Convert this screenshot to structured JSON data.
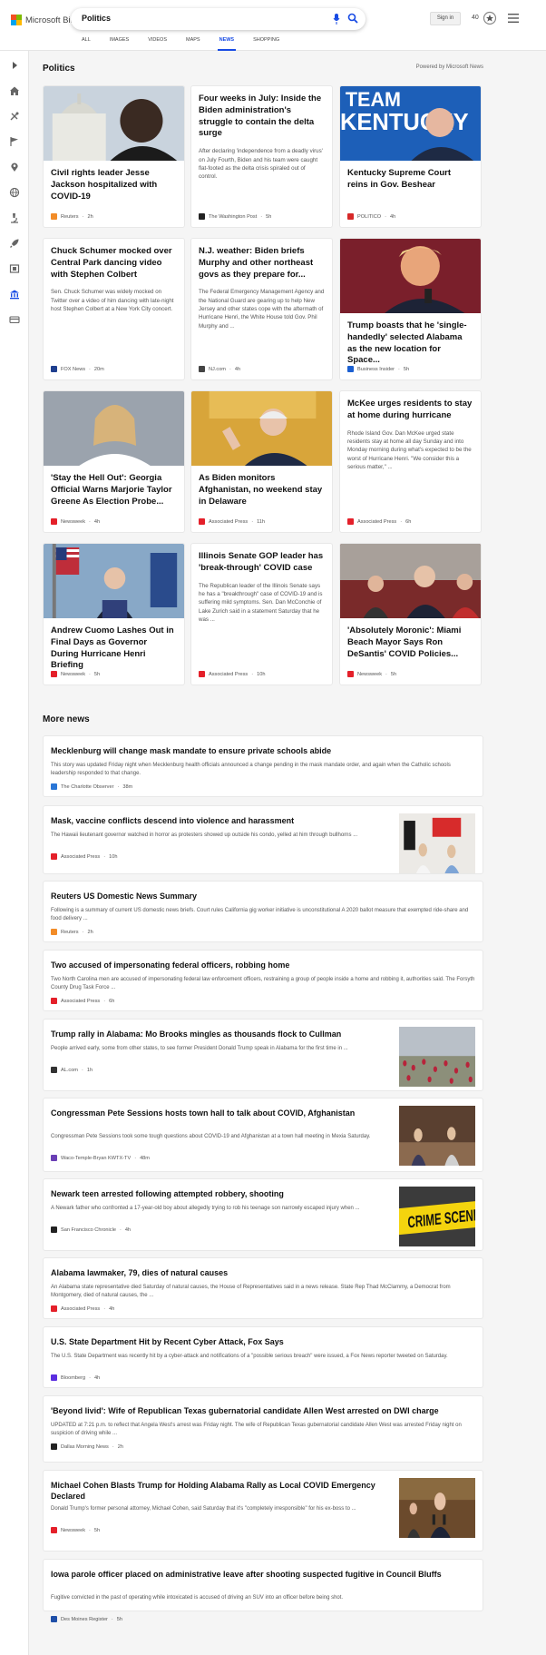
{
  "header": {
    "brand": "Microsoft Bing",
    "search_query": "Politics",
    "signin_label": "Sign in",
    "points": "40",
    "nav_items": [
      "ALL",
      "IMAGES",
      "VIDEOS",
      "MAPS",
      "NEWS",
      "SHOPPING"
    ],
    "active_nav": "NEWS"
  },
  "rail": {
    "icons": [
      "chevron-right-icon",
      "home-icon",
      "sports-icon",
      "flag-icon",
      "location-icon",
      "globe-icon",
      "microscope-icon",
      "rocket-icon",
      "film-icon",
      "bank-icon",
      "card-icon"
    ]
  },
  "politics": {
    "title": "Politics",
    "powered_by": "Powered by Microsoft News",
    "cards": [
      {
        "title": "Civil rights leader Jesse Jackson hospitalized with COVID-19",
        "desc": "",
        "source": "Reuters",
        "time": "2h",
        "src_color": "#f28c28",
        "image": "jackson"
      },
      {
        "title": "Four weeks in July: Inside the Biden administration's struggle to contain the delta surge",
        "desc": "After declaring 'independence from a deadly virus' on July Fourth, Biden and his team were caught flat-footed as the delta crisis spiraled out of control.",
        "source": "The Washington Post",
        "time": "5h",
        "src_color": "#222222",
        "image": ""
      },
      {
        "title": "Kentucky Supreme Court reins in Gov. Beshear",
        "desc": "",
        "source": "POLITICO",
        "time": "4h",
        "src_color": "#d62828",
        "image": "kentucky"
      },
      {
        "title": "Chuck Schumer mocked over Central Park dancing video with Stephen Colbert",
        "desc": "Sen. Chuck Schumer was widely mocked on Twitter over a video of him dancing with late-night host Stephen Colbert at a New York City concert.",
        "source": "FOX News",
        "time": "20m",
        "src_color": "#1f3f8f",
        "image": ""
      },
      {
        "title": "N.J. weather: Biden briefs Murphy and other northeast govs as they prepare for...",
        "desc": "The Federal Emergency Management Agency and the National Guard are gearing up to help New Jersey and other states cope with the aftermath of Hurricane Henri, the White House told Gov. Phil Murphy and ...",
        "source": "NJ.com",
        "time": "4h",
        "src_color": "#444444",
        "image": ""
      },
      {
        "title": "Trump boasts that he 'single-handedly' selected Alabama as the new location for Space...",
        "desc": "",
        "source": "Business Insider",
        "time": "5h",
        "src_color": "#1b5fd1",
        "image": "trump"
      },
      {
        "title": "'Stay the Hell Out': Georgia Official Warns Marjorie Taylor Greene As Election Probe...",
        "desc": "",
        "source": "Newsweek",
        "time": "4h",
        "src_color": "#e4202a",
        "image": "greene"
      },
      {
        "title": "As Biden monitors Afghanistan, no weekend stay in Delaware",
        "desc": "",
        "source": "Associated Press",
        "time": "11h",
        "src_color": "#e4202a",
        "image": "biden"
      },
      {
        "title": "McKee urges residents to stay at home during hurricane",
        "desc": "Rhode Island Gov. Dan McKee urged state residents stay at home all day Sunday and into Monday morning during what's expected to be the worst of Hurricane Henri. \"We consider this a serious matter,\" ...",
        "source": "Associated Press",
        "time": "6h",
        "src_color": "#e4202a",
        "image": ""
      },
      {
        "title": "Andrew Cuomo Lashes Out in Final Days as Governor During Hurricane Henri Briefing",
        "desc": "",
        "source": "Newsweek",
        "time": "5h",
        "src_color": "#e4202a",
        "image": "cuomo"
      },
      {
        "title": "Illinois Senate GOP leader has 'break-through' COVID case",
        "desc": "The Republican leader of the Illinois Senate says he has a \"breakthrough\" case of COVID-19 and is suffering mild symptoms. Sen. Dan McConchie of Lake Zurich said in a statement Saturday that he was ...",
        "source": "Associated Press",
        "time": "10h",
        "src_color": "#e4202a",
        "image": ""
      },
      {
        "title": "'Absolutely Moronic': Miami Beach Mayor Says Ron DeSantis' COVID Policies...",
        "desc": "",
        "source": "Newsweek",
        "time": "5h",
        "src_color": "#e4202a",
        "image": "desantis"
      }
    ]
  },
  "more_news": {
    "title": "More news",
    "items": [
      {
        "title": "Mecklenburg will change mask mandate to ensure private schools abide",
        "desc": "This story was updated Friday night when Mecklenburg health officials announced a change pending in the mask mandate order, and again when the Catholic schools leadership responded to that change.",
        "source": "The Charlotte Observer",
        "time": "38m",
        "src_color": "#2a76d6",
        "image": ""
      },
      {
        "title": "Mask, vaccine conflicts descend into violence and harassment",
        "desc": "The Hawaii lieutenant governor watched in horror as protesters showed up outside his condo, yelled at him through bullhorns ...",
        "source": "Associated Press",
        "time": "10h",
        "src_color": "#e4202a",
        "image": "protest"
      },
      {
        "title": "Reuters US Domestic News Summary",
        "desc": "Following is a summary of current US domestic news briefs. Court rules California gig worker initiative is unconstitutional A 2020 ballot measure that exempted ride-share and food delivery ...",
        "source": "Reuters",
        "time": "2h",
        "src_color": "#f28c28",
        "image": ""
      },
      {
        "title": "Two accused of impersonating federal officers, robbing home",
        "desc": "Two North Carolina men are accused of impersonating federal law enforcement officers, restraining a group of people inside a home and robbing it, authorities said. The Forsyth County Drug Task Force ...",
        "source": "Associated Press",
        "time": "6h",
        "src_color": "#e4202a",
        "image": ""
      },
      {
        "title": "Trump rally in Alabama: Mo Brooks mingles as thousands flock to Cullman",
        "desc": "People arrived early, some from other states, to see former President Donald Trump speak in Alabama for the first time in ...",
        "source": "AL.com",
        "time": "1h",
        "src_color": "#333333",
        "image": "rally"
      },
      {
        "title": "Congressman Pete Sessions hosts town hall to talk about COVID, Afghanistan",
        "desc": "Congressman Pete Sessions took some tough questions about COVID-19 and Afghanistan at a town hall meeting in Mexia Saturday.",
        "source": "Waco-Temple-Bryan KWTX-TV",
        "time": "48m",
        "src_color": "#6a3fb5",
        "image": "townhall"
      },
      {
        "title": "Newark teen arrested following attempted robbery, shooting",
        "desc": "A Newark father who confronted a 17-year-old boy about allegedly trying to rob his teenage son narrowly escaped injury when ...",
        "source": "San Francisco Chronicle",
        "time": "4h",
        "src_color": "#222222",
        "image": "crime"
      },
      {
        "title": "Alabama lawmaker, 79, dies of natural causes",
        "desc": "An Alabama state representative died Saturday of natural causes, the House of Representatives said in a news release. State Rep Thad McClammy, a Democrat from Montgomery, died of natural causes, the ...",
        "source": "Associated Press",
        "time": "4h",
        "src_color": "#e4202a",
        "image": ""
      },
      {
        "title": "U.S. State Department Hit by Recent Cyber Attack, Fox Says",
        "desc": "The U.S. State Department was recently hit by a cyber-attack and notifications of a \"possible serious breach\" were issued, a Fox News reporter tweeted on Saturday.",
        "source": "Bloomberg",
        "time": "4h",
        "src_color": "#5b2ee0",
        "image": ""
      },
      {
        "title": "'Beyond livid': Wife of Republican Texas gubernatorial candidate Allen West arrested on DWI charge",
        "desc": "UPDATED at 7:21 p.m. to reflect that Angela West's arrest was Friday night. The wife of Republican Texas gubernatorial candidate Allen West was arrested Friday night on suspicion of driving while ...",
        "source": "Dallas Morning News",
        "time": "2h",
        "src_color": "#222222",
        "image": ""
      },
      {
        "title": "Michael Cohen Blasts Trump for Holding Alabama Rally as Local COVID Emergency Declared",
        "desc": "Donald Trump's former personal attorney, Michael Cohen, said Saturday that it's \"completely irresponsible\" for his ex-boss to ...",
        "source": "Newsweek",
        "time": "5h",
        "src_color": "#e4202a",
        "image": "cohen"
      },
      {
        "title": "Iowa parole officer placed on administrative leave after shooting suspected fugitive in Council Bluffs",
        "desc": "Fugitive convicted in the past of operating while intoxicated is accused of driving an SUV into an officer before being shot.",
        "source": "Des Moines Register",
        "time": "5h",
        "src_color": "#1f4fa8",
        "image": ""
      }
    ]
  },
  "colors": {
    "accent": "#174ae4",
    "page_bg": "#f5f5f5"
  }
}
